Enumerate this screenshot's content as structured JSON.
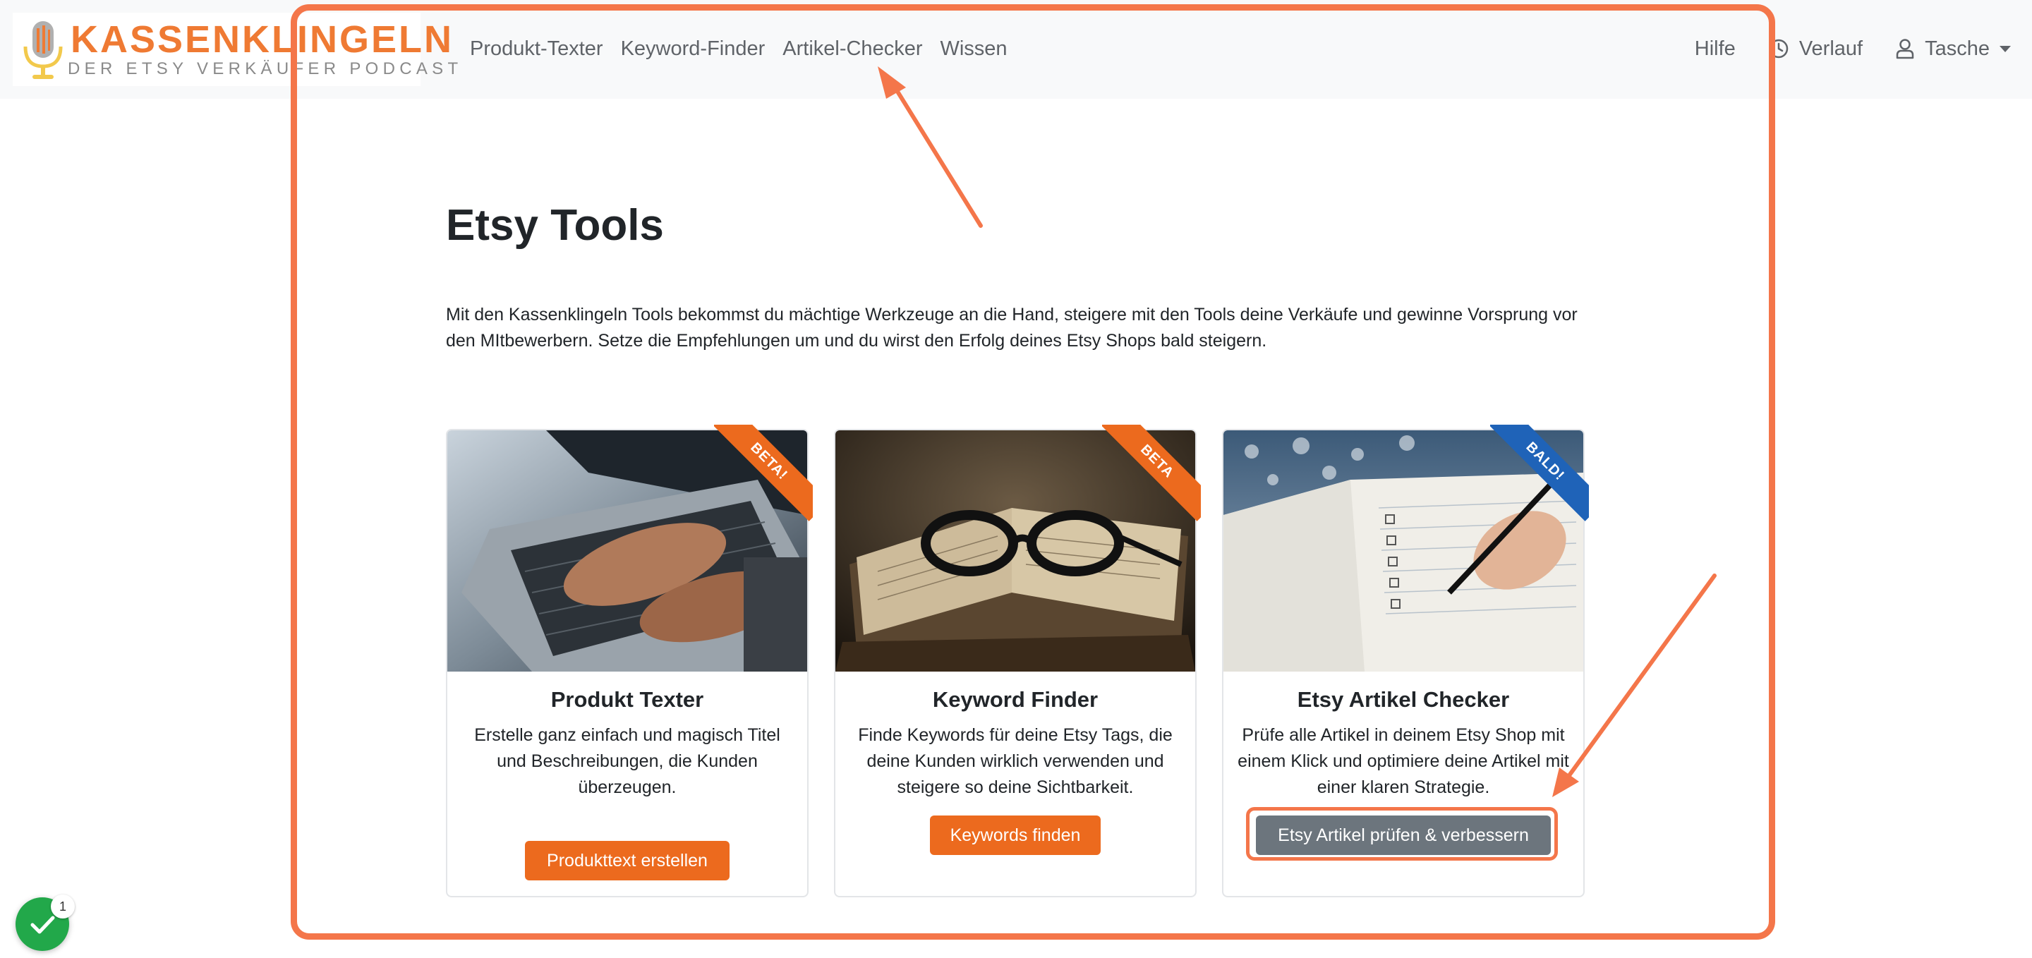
{
  "brand": {
    "title": "KASSENKLINGELN",
    "subtitle": "DER ETSY VERKÄUFER PODCAST"
  },
  "nav": {
    "links": [
      "Produkt-Texter",
      "Keyword-Finder",
      "Artikel-Checker",
      "Wissen"
    ],
    "help": "Hilfe",
    "history": "Verlauf",
    "user": "Tasche"
  },
  "main": {
    "title": "Etsy Tools",
    "intro": "Mit den Kassenklingeln Tools bekommst du mächtige Werkzeuge an die Hand, steigere mit den Tools deine Verkäufe und gewinne Vorsprung vor den MItbewerbern. Setze die Empfehlungen um und du wirst den Erfolg deines Etsy Shops bald steigern."
  },
  "cards": [
    {
      "ribbon": "BETA!",
      "title": "Produkt Texter",
      "text": "Erstelle ganz einfach und magisch Titel und Beschreibungen, die Kunden überzeugen.",
      "button": "Produkttext erstellen"
    },
    {
      "ribbon": "BETA",
      "title": "Keyword Finder",
      "text": "Finde Keywords für deine Etsy Tags, die deine Kunden wirklich verwenden und steigere so deine Sichtbarkeit.",
      "button": "Keywords finden"
    },
    {
      "ribbon": "BALD!",
      "title": "Etsy Artikel Checker",
      "text": "Prüfe alle Artikel in deinem Etsy Shop mit einem Klick und optimiere deine Artikel mit einer klaren Strategie.",
      "button": "Etsy Artikel prüfen & verbessern"
    }
  ],
  "toast": {
    "count": "1"
  },
  "colors": {
    "brand_orange": "#ef7a33",
    "button_orange": "#ec6a1e",
    "button_grey": "#6c757d",
    "ribbon_blue": "#1f63b8",
    "annotation": "#f4764a",
    "success_green": "#22a84a"
  }
}
